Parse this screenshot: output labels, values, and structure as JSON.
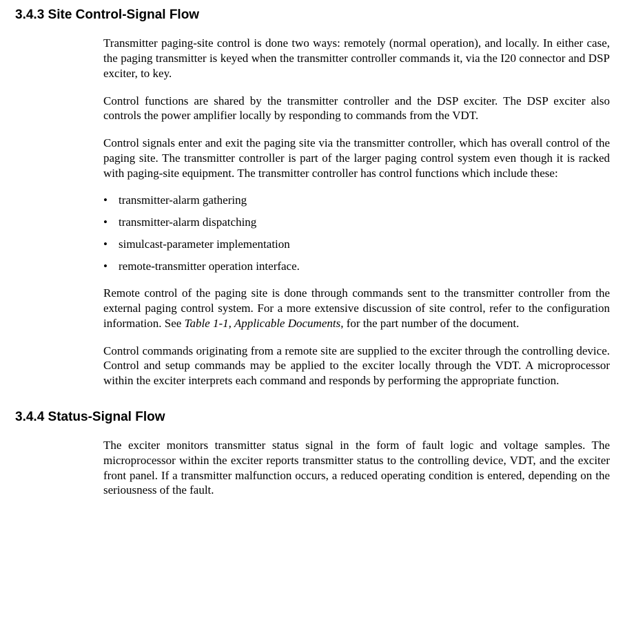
{
  "section1": {
    "heading": "3.4.3 Site Control-Signal Flow",
    "p1": "Transmitter paging-site control is done two ways: remotely (normal operation), and locally. In either case, the paging transmitter is keyed when the transmitter controller commands it, via the I20 connector and DSP exciter, to key.",
    "p2": "Control functions are shared by the transmitter controller and the DSP exciter. The DSP exciter also controls the power amplifier locally by responding to commands from the VDT.",
    "p3": "Control signals enter and exit the paging site via the transmitter controller, which has overall control of the paging site. The transmitter controller is part of the larger paging control system even though it is racked with paging-site equipment. The transmitter controller has control functions which include these:",
    "bullets": [
      "transmitter-alarm gathering",
      "transmitter-alarm dispatching",
      "simulcast-parameter implementation",
      "remote-transmitter operation interface."
    ],
    "p4_a": "Remote control of the paging site is done through commands sent to the transmitter controller from the external paging control system. For a more extensive discussion of site control, refer to the configuration information. See ",
    "p4_ref": "Table 1-1, Applicable Documents,",
    "p4_b": " for the part number of the document.",
    "p5": "Control commands originating from a remote site are supplied to the exciter through the controlling device. Control and setup commands may be applied to the exciter locally through the VDT. A microprocessor within the exciter interprets each command and responds by performing the appropriate function."
  },
  "section2": {
    "heading": "3.4.4 Status-Signal Flow",
    "p1": "The exciter monitors transmitter status signal in the form of fault logic and voltage samples. The microprocessor within the exciter reports transmitter status to the controlling device, VDT, and the exciter front panel. If a transmitter malfunction occurs, a reduced operating condition is entered, depending on the seriousness of the fault."
  }
}
